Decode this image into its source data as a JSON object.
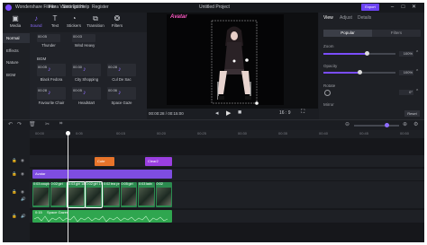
{
  "app": {
    "name": "Wondershare Filmora Video Editor",
    "menus": [
      "File",
      "Settings",
      "Help",
      "Register"
    ],
    "project_title": "Untitled Project",
    "export_label": "Export"
  },
  "toolbar": [
    {
      "label": "Media",
      "icon": "folder-icon"
    },
    {
      "label": "Sound",
      "icon": "music-note-icon"
    },
    {
      "label": "Text",
      "icon": "text-icon"
    },
    {
      "label": "Stickers",
      "icon": "sticker-icon"
    },
    {
      "label": "Transition",
      "icon": "transition-icon"
    },
    {
      "label": "Filters",
      "icon": "filter-icon"
    }
  ],
  "media_sidebar": [
    "Normal",
    "Effects",
    "Nature",
    "BGM"
  ],
  "media": {
    "top_row_times": [
      "00:05",
      "00:03"
    ],
    "top_row_captions": [
      "Thunder",
      "Wind Heavy"
    ],
    "bgm_heading": "BGM",
    "bgm_items": [
      {
        "time": "00:05",
        "caption": "Black Fedora"
      },
      {
        "time": "00:30",
        "caption": "City Shopping"
      },
      {
        "time": "00:28",
        "caption": "Cul De Sac"
      },
      {
        "time": "00:28",
        "caption": "Favourite Chair"
      },
      {
        "time": "00:05",
        "caption": "Headstart"
      },
      {
        "time": "00:36",
        "caption": "Space Gaze"
      }
    ]
  },
  "preview": {
    "overlay_text": "Avatar",
    "timecode": "00:00:28 / 00:15:00",
    "ratio": "16 : 9"
  },
  "right_panel": {
    "tabs": [
      "View",
      "Adjust",
      "Details"
    ],
    "segments": [
      "Popular",
      "Filters"
    ],
    "props": [
      {
        "label": "Zoom",
        "value": "100%",
        "level": 0.6
      },
      {
        "label": "Opacity",
        "value": "100%",
        "level": 0.5
      },
      {
        "label": "Rotate",
        "value": "0°"
      },
      {
        "label": "Mirror"
      }
    ],
    "reset_label": "Reset"
  },
  "timeline": {
    "ruler": [
      "00:00",
      "0:05",
      "00:15",
      "00:20",
      "00:25",
      "00:30",
      "00:35",
      "00:40",
      "00:45",
      "00:50"
    ],
    "clips": {
      "stickers": [
        {
          "label": "Cute"
        },
        {
          "label": "Clear2"
        }
      ],
      "text": "Avatar",
      "video_times": [
        "0:03",
        "0:02",
        "0:03",
        "0:02",
        "0:02",
        "0:05",
        "0:03",
        "0:02"
      ],
      "video_names": [
        "couple",
        "girl",
        "girl 18",
        "girl 19",
        "tea pre",
        "girl",
        "ladv"
      ],
      "audio": {
        "time": "0:15",
        "name": "Space Gazer"
      }
    }
  },
  "colors": {
    "accent": "#7b4dff",
    "video": "#2b8b4f",
    "audio": "#2fa64f",
    "text_clip": "#7e4de0",
    "sticker_orange": "#e8742a",
    "sticker_purple": "#9a3fe0"
  }
}
